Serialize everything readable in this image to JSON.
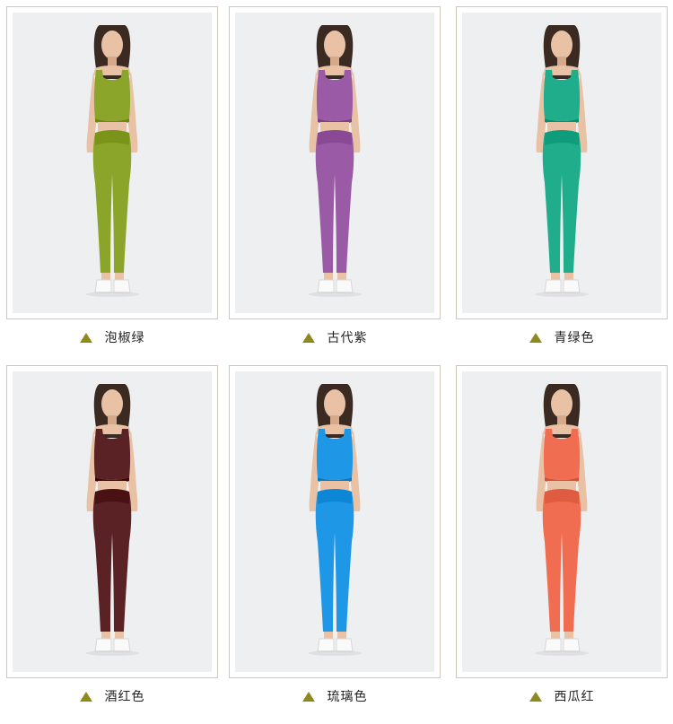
{
  "products": [
    {
      "label": "泡椒绿",
      "color": "#8aa52a",
      "icon": "triangle-up-icon"
    },
    {
      "label": "古代紫",
      "color": "#9a5aa5",
      "icon": "triangle-up-icon"
    },
    {
      "label": "青绿色",
      "color": "#1fad8c",
      "icon": "triangle-up-icon"
    },
    {
      "label": "酒红色",
      "color": "#5b2226",
      "icon": "triangle-up-icon"
    },
    {
      "label": "琉璃色",
      "color": "#1e98e6",
      "icon": "triangle-up-icon"
    },
    {
      "label": "西瓜红",
      "color": "#f06d52",
      "icon": "triangle-up-icon"
    }
  ],
  "colors": {
    "triangle": "#8c8a1c",
    "frame_border": "#cfc7b8",
    "photo_bg": "#eeeff1"
  }
}
